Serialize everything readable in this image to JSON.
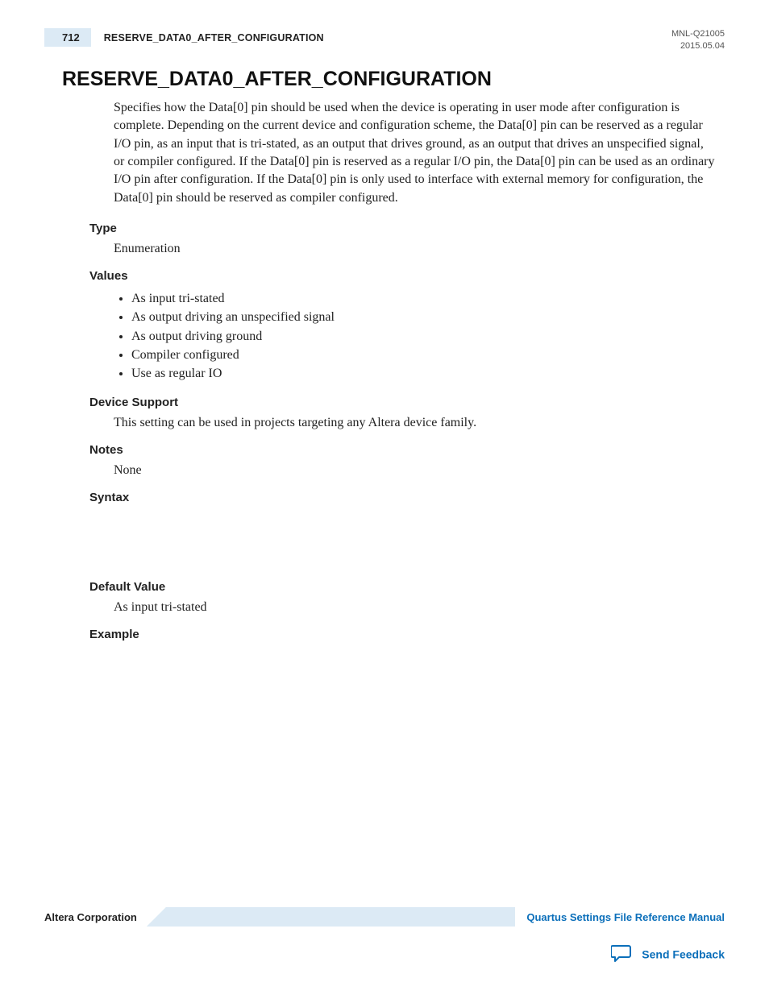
{
  "header": {
    "page_number": "712",
    "running_title": "RESERVE_DATA0_AFTER_CONFIGURATION",
    "doc_id": "MNL-Q21005",
    "date": "2015.05.04"
  },
  "title": "RESERVE_DATA0_AFTER_CONFIGURATION",
  "description": "Specifies how the Data[0] pin should be used when the device is operating in user mode after configuration is complete. Depending on the current device and configuration scheme, the Data[0] pin can be reserved as a regular I/O pin, as an input that is tri-stated, as an output that drives ground, as an output that drives an unspecified signal, or compiler configured. If the Data[0] pin is reserved as a regular I/O pin, the Data[0] pin can be used as an ordinary I/O pin after configuration. If the Data[0] pin is only used to interface with external memory for configuration, the Data[0] pin should be reserved as compiler configured.",
  "sections": {
    "type_label": "Type",
    "type_value": "Enumeration",
    "values_label": "Values",
    "values_list": [
      "As input tri-stated",
      "As output driving an unspecified signal",
      "As output driving ground",
      "Compiler configured",
      "Use as regular IO"
    ],
    "device_support_label": "Device Support",
    "device_support_value": "This setting can be used in projects targeting any Altera device family.",
    "notes_label": "Notes",
    "notes_value": "None",
    "syntax_label": "Syntax",
    "default_value_label": "Default Value",
    "default_value_value": "As input tri-stated",
    "example_label": "Example"
  },
  "footer": {
    "company": "Altera Corporation",
    "manual": "Quartus Settings File Reference Manual",
    "feedback": "Send Feedback"
  }
}
